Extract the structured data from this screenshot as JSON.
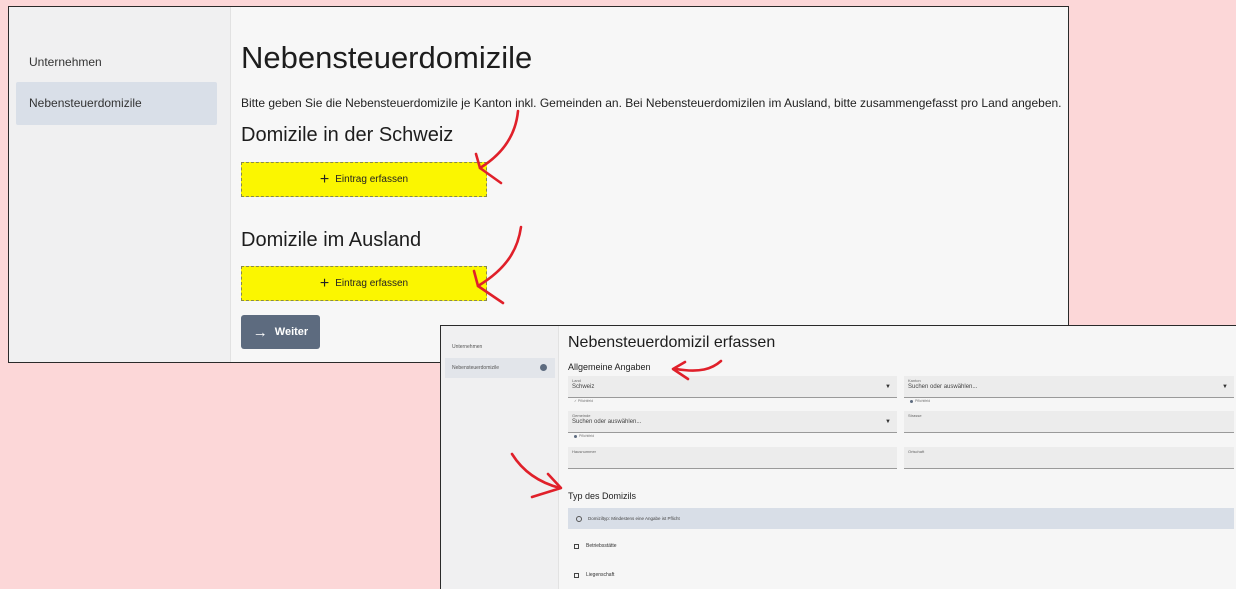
{
  "top": {
    "sidebar": {
      "items": [
        {
          "label": "Unternehmen"
        },
        {
          "label": "Nebensteuerdomizile"
        }
      ]
    },
    "title": "Nebensteuerdomizile",
    "description": "Bitte geben Sie die Nebensteuerdomizile je Kanton inkl. Gemeinden an. Bei Nebensteuerdomizilen im Ausland, bitte zusammengefasst pro Land angeben.",
    "section_schweiz": "Domizile in der Schweiz",
    "section_ausland": "Domizile im Ausland",
    "add_label": "Eintrag erfassen",
    "add_icon": "plus-icon",
    "weiter_label": "Weiter",
    "weiter_icon": "arrow-right-icon",
    "highlight_color": "#fbf600",
    "button_color": "#5d6b7f"
  },
  "bottom": {
    "sidebar": {
      "items": [
        {
          "label": "Unternehmen"
        },
        {
          "label": "Nebensteuerdomizile"
        }
      ]
    },
    "title": "Nebensteuerdomizil erfassen",
    "section_general": "Allgemeine Angaben",
    "fields": {
      "land": {
        "label": "Land",
        "value": "Schweiz",
        "hint": "Pflichtfeld"
      },
      "kanton": {
        "label": "Kanton",
        "placeholder": "Suchen oder auswählen...",
        "hint": "Pflichtfeld"
      },
      "gemeinde": {
        "label": "Gemeinde",
        "placeholder": "Suchen oder auswählen...",
        "hint": "Pflichtfeld"
      },
      "strasse": {
        "label": "Strasse"
      },
      "hausnummer": {
        "label": "Hausnummer"
      },
      "ortschaft": {
        "label": "Ortschaft"
      }
    },
    "section_type": "Typ des Domizils",
    "info_text": "Domiziltyp: Mindestens eine Angabe ist Pflicht",
    "checkboxes": [
      {
        "label": "Betriebsstätte"
      },
      {
        "label": "Liegenschaft"
      }
    ]
  },
  "annotation_color": "#e0202a"
}
